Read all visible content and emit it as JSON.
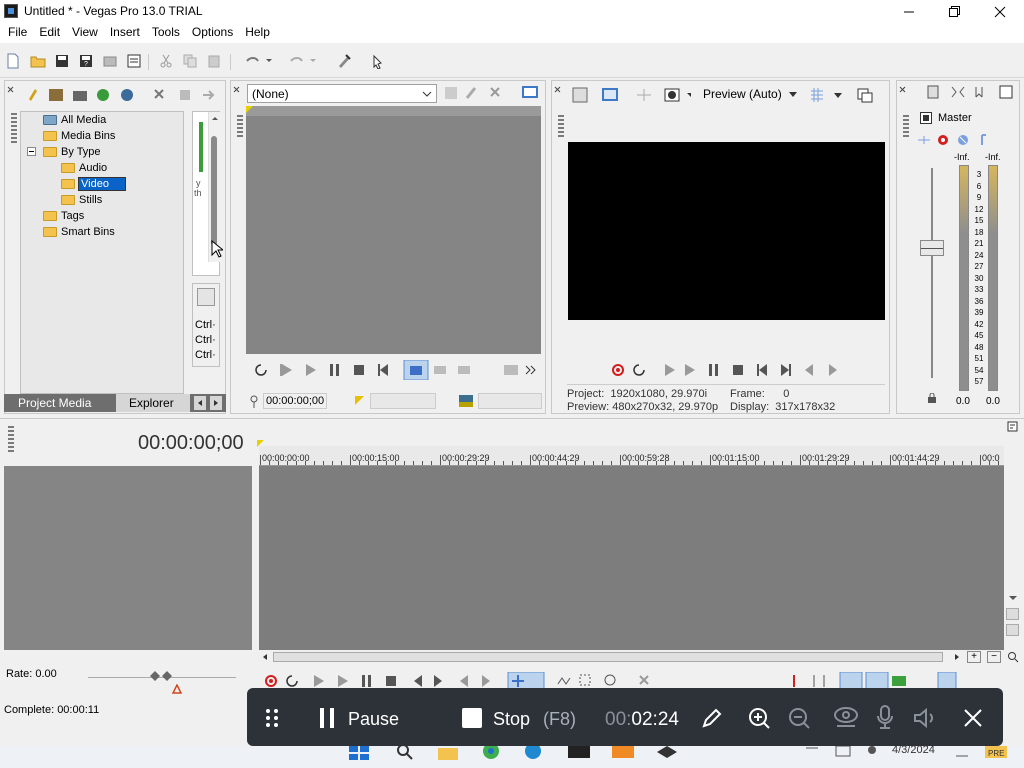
{
  "window": {
    "title": "Untitled * - Vegas Pro 13.0 TRIAL",
    "minimize_icon": "minimize-icon",
    "maximize_icon": "maximize-icon",
    "close_icon": "close-icon"
  },
  "menubar": {
    "items": [
      "File",
      "Edit",
      "View",
      "Insert",
      "Tools",
      "Options",
      "Help"
    ]
  },
  "project_media": {
    "tree": [
      {
        "label": "All Media",
        "level": 1,
        "icon": "media-icon"
      },
      {
        "label": "Media Bins",
        "level": 1,
        "icon": "folder-icon"
      },
      {
        "label": "By Type",
        "level": 1,
        "icon": "folder-icon",
        "expanded": true
      },
      {
        "label": "Audio",
        "level": 2,
        "icon": "folder-icon"
      },
      {
        "label": "Video",
        "level": 2,
        "icon": "folder-icon",
        "selected": true
      },
      {
        "label": "Stills",
        "level": 2,
        "icon": "folder-icon"
      },
      {
        "label": "Tags",
        "level": 1,
        "icon": "folder-icon"
      },
      {
        "label": "Smart Bins",
        "level": 1,
        "icon": "folder-icon"
      }
    ],
    "partial_text_1": "y",
    "partial_text_2": "th",
    "ctrl_labels": [
      "Ctrl·",
      "Ctrl·",
      "Ctrl·"
    ],
    "tabs": [
      "Project Media",
      "Explorer"
    ]
  },
  "trimmer": {
    "select_value": "(None)",
    "timecode": "00:00:00;00"
  },
  "preview": {
    "mode": "Preview (Auto)",
    "project_label": "Project:",
    "project_value": "1920x1080, 29.970i",
    "frame_label": "Frame:",
    "frame_value": "0",
    "preview_label": "Preview:",
    "preview_value": "480x270x32, 29.970p",
    "display_label": "Display:",
    "display_value": "317x178x32"
  },
  "master": {
    "title": "Master",
    "peak_left": "-Inf.",
    "peak_right": "-Inf.",
    "scale": [
      "3",
      "6",
      "9",
      "12",
      "15",
      "18",
      "21",
      "24",
      "27",
      "30",
      "33",
      "36",
      "39",
      "42",
      "45",
      "48",
      "51",
      "54",
      "57"
    ],
    "bottom_left": "0.0",
    "bottom_right": "0.0"
  },
  "timeline": {
    "timecode": "00:00:00;00",
    "ruler": [
      "00:00:00:00",
      "00:00:15:00",
      "00:00:29:29",
      "00:00:44:29",
      "00:00:59:28",
      "00:01:15:00",
      "00:01:29:29",
      "00:01:44:29",
      "00:0"
    ],
    "rate": "Rate: 0.00",
    "complete": "Complete: 00:00:11"
  },
  "recorder": {
    "pause_label": "Pause",
    "stop_label": "Stop",
    "stop_shortcut": "(F8)",
    "time_dim": "00:",
    "time": "02:24"
  },
  "taskbar": {
    "date": "4/3/2024"
  },
  "colors": {
    "accent": "#0a64c8",
    "timeline_bg": "#7d7d7d",
    "panel_gray": "#858585",
    "recorder_bg": "#2d3238",
    "record_red": "#d21e1e"
  }
}
